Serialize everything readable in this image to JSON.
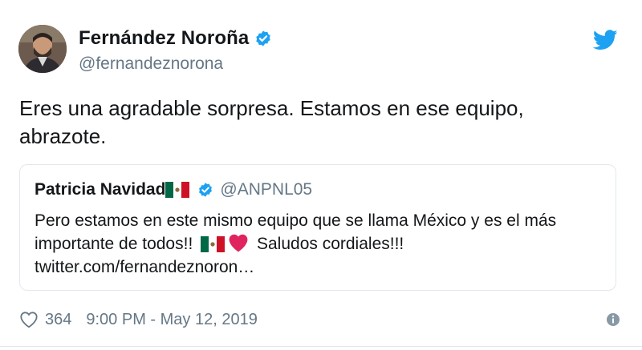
{
  "tweet": {
    "display_name": "Fernández Noroña",
    "handle": "@fernandeznorona",
    "text_line1": "Eres una agradable sorpresa. Estamos en ese equipo,",
    "text_line2": "abrazote."
  },
  "quoted_tweet": {
    "display_name": "Patricia Navidad",
    "handle": "@ANPNL05",
    "text_line1": "Pero estamos en este mismo equipo que se llama México y es el más",
    "text_line2_a": "importante de todos!!",
    "text_line2_b": "Saludos cordiales!!!",
    "text_line3": "twitter.com/fernandeznoron…"
  },
  "footer": {
    "like_count": "364",
    "timestamp": "9:00 PM - May 12, 2019"
  },
  "colors": {
    "twitter_blue": "#1da1f2",
    "secondary_text": "#657786",
    "border": "#e1e8ed",
    "heart_red": "#e0245e"
  },
  "icons": {
    "verified": "verified-badge-icon",
    "bird": "twitter-bird-icon",
    "flag": "mexico-flag-icon",
    "heart": "red-heart-icon",
    "like": "like-heart-outline-icon",
    "info": "info-icon"
  }
}
